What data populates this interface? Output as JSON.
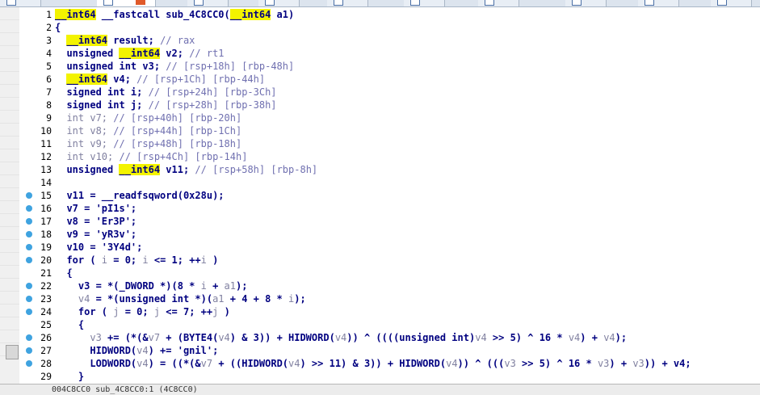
{
  "status": {
    "location": "004C8CC0 sub_4C8CC0:1 (4C8CC0)"
  },
  "code": {
    "lines": [
      {
        "n": "1",
        "dot": false,
        "s": [
          [
            "hl",
            "__int64"
          ],
          [
            "k",
            " __fastcall sub_4C8CC0("
          ],
          [
            "hl",
            "__int64"
          ],
          [
            "k",
            " a1)"
          ]
        ]
      },
      {
        "n": "2",
        "dot": false,
        "s": [
          [
            "k",
            "{"
          ]
        ]
      },
      {
        "n": "3",
        "dot": false,
        "s": [
          [
            "k",
            "  "
          ],
          [
            "hl",
            "__int64"
          ],
          [
            "k",
            " result; "
          ],
          [
            "c",
            "// rax"
          ]
        ]
      },
      {
        "n": "4",
        "dot": false,
        "s": [
          [
            "k",
            "  unsigned "
          ],
          [
            "hl",
            "__int64"
          ],
          [
            "k",
            " v2; "
          ],
          [
            "c",
            "// rt1"
          ]
        ]
      },
      {
        "n": "5",
        "dot": false,
        "s": [
          [
            "k",
            "  unsigned int v3; "
          ],
          [
            "c",
            "// [rsp+18h] [rbp-48h]"
          ]
        ]
      },
      {
        "n": "6",
        "dot": false,
        "s": [
          [
            "k",
            "  "
          ],
          [
            "hl",
            "__int64"
          ],
          [
            "k",
            " v4; "
          ],
          [
            "c",
            "// [rsp+1Ch] [rbp-44h]"
          ]
        ]
      },
      {
        "n": "7",
        "dot": false,
        "s": [
          [
            "k",
            "  signed int i; "
          ],
          [
            "c",
            "// [rsp+24h] [rbp-3Ch]"
          ]
        ]
      },
      {
        "n": "8",
        "dot": false,
        "s": [
          [
            "k",
            "  signed int j; "
          ],
          [
            "c",
            "// [rsp+28h] [rbp-38h]"
          ]
        ]
      },
      {
        "n": "9",
        "dot": false,
        "s": [
          [
            "g",
            "  int v7; "
          ],
          [
            "c",
            "// [rsp+40h] [rbp-20h]"
          ]
        ]
      },
      {
        "n": "10",
        "dot": false,
        "s": [
          [
            "g",
            "  int v8; "
          ],
          [
            "c",
            "// [rsp+44h] [rbp-1Ch]"
          ]
        ]
      },
      {
        "n": "11",
        "dot": false,
        "s": [
          [
            "g",
            "  int v9; "
          ],
          [
            "c",
            "// [rsp+48h] [rbp-18h]"
          ]
        ]
      },
      {
        "n": "12",
        "dot": false,
        "s": [
          [
            "g",
            "  int v10; "
          ],
          [
            "c",
            "// [rsp+4Ch] [rbp-14h]"
          ]
        ]
      },
      {
        "n": "13",
        "dot": false,
        "s": [
          [
            "k",
            "  unsigned "
          ],
          [
            "hl",
            "__int64"
          ],
          [
            "k",
            " v11; "
          ],
          [
            "c",
            "// [rsp+58h] [rbp-8h]"
          ]
        ]
      },
      {
        "n": "14",
        "dot": false,
        "s": [
          [
            "k",
            ""
          ]
        ]
      },
      {
        "n": "15",
        "dot": true,
        "s": [
          [
            "k",
            "  v11 = __readfsqword(0x28u);"
          ]
        ]
      },
      {
        "n": "16",
        "dot": true,
        "s": [
          [
            "k",
            "  v7 = 'pI1s';"
          ]
        ]
      },
      {
        "n": "17",
        "dot": true,
        "s": [
          [
            "k",
            "  v8 = 'Er3P';"
          ]
        ]
      },
      {
        "n": "18",
        "dot": true,
        "s": [
          [
            "k",
            "  v9 = 'yR3v';"
          ]
        ]
      },
      {
        "n": "19",
        "dot": true,
        "s": [
          [
            "k",
            "  v10 = '3Y4d';"
          ]
        ]
      },
      {
        "n": "20",
        "dot": true,
        "s": [
          [
            "k",
            "  for ( "
          ],
          [
            "g",
            "i"
          ],
          [
            "k",
            " = 0; "
          ],
          [
            "g",
            "i"
          ],
          [
            "k",
            " <= 1; ++"
          ],
          [
            "g",
            "i"
          ],
          [
            "k",
            " )"
          ]
        ]
      },
      {
        "n": "21",
        "dot": false,
        "s": [
          [
            "k",
            "  {"
          ]
        ]
      },
      {
        "n": "22",
        "dot": true,
        "s": [
          [
            "k",
            "    v3 = *(_DWORD *)(8 * "
          ],
          [
            "g",
            "i"
          ],
          [
            "k",
            " + "
          ],
          [
            "g",
            "a1"
          ],
          [
            "k",
            ");"
          ]
        ]
      },
      {
        "n": "23",
        "dot": true,
        "s": [
          [
            "k",
            "    "
          ],
          [
            "g",
            "v4"
          ],
          [
            "k",
            " = *(unsigned int *)("
          ],
          [
            "g",
            "a1"
          ],
          [
            "k",
            " + 4 + 8 * "
          ],
          [
            "g",
            "i"
          ],
          [
            "k",
            ");"
          ]
        ]
      },
      {
        "n": "24",
        "dot": true,
        "s": [
          [
            "k",
            "    for ( "
          ],
          [
            "g",
            "j"
          ],
          [
            "k",
            " = 0; "
          ],
          [
            "g",
            "j"
          ],
          [
            "k",
            " <= 7; ++"
          ],
          [
            "g",
            "j"
          ],
          [
            "k",
            " )"
          ]
        ]
      },
      {
        "n": "25",
        "dot": false,
        "s": [
          [
            "k",
            "    {"
          ]
        ]
      },
      {
        "n": "26",
        "dot": true,
        "s": [
          [
            "k",
            "      "
          ],
          [
            "g",
            "v3"
          ],
          [
            "k",
            " += (*(&"
          ],
          [
            "g",
            "v7"
          ],
          [
            "k",
            " + (BYTE4("
          ],
          [
            "g",
            "v4"
          ],
          [
            "k",
            ") & 3)) + HIDWORD("
          ],
          [
            "g",
            "v4"
          ],
          [
            "k",
            ")) ^ ((((unsigned int)"
          ],
          [
            "g",
            "v4"
          ],
          [
            "k",
            " >> 5) ^ 16 * "
          ],
          [
            "g",
            "v4"
          ],
          [
            "k",
            ") + "
          ],
          [
            "g",
            "v4"
          ],
          [
            "k",
            ");"
          ]
        ]
      },
      {
        "n": "27",
        "dot": true,
        "s": [
          [
            "k",
            "      HIDWORD("
          ],
          [
            "g",
            "v4"
          ],
          [
            "k",
            ") += 'gnil';"
          ]
        ]
      },
      {
        "n": "28",
        "dot": true,
        "s": [
          [
            "k",
            "      LODWORD("
          ],
          [
            "g",
            "v4"
          ],
          [
            "k",
            ") = ((*(&"
          ],
          [
            "g",
            "v7"
          ],
          [
            "k",
            " + ((HIDWORD("
          ],
          [
            "g",
            "v4"
          ],
          [
            "k",
            ") >> 11) & 3)) + HIDWORD("
          ],
          [
            "g",
            "v4"
          ],
          [
            "k",
            ")) ^ ((("
          ],
          [
            "g",
            "v3"
          ],
          [
            "k",
            " >> 5) ^ 16 * "
          ],
          [
            "g",
            "v3"
          ],
          [
            "k",
            ") + "
          ],
          [
            "g",
            "v3"
          ],
          [
            "k",
            ")) + v4;"
          ]
        ]
      },
      {
        "n": "29",
        "dot": false,
        "s": [
          [
            "k",
            "    }"
          ]
        ]
      }
    ]
  }
}
